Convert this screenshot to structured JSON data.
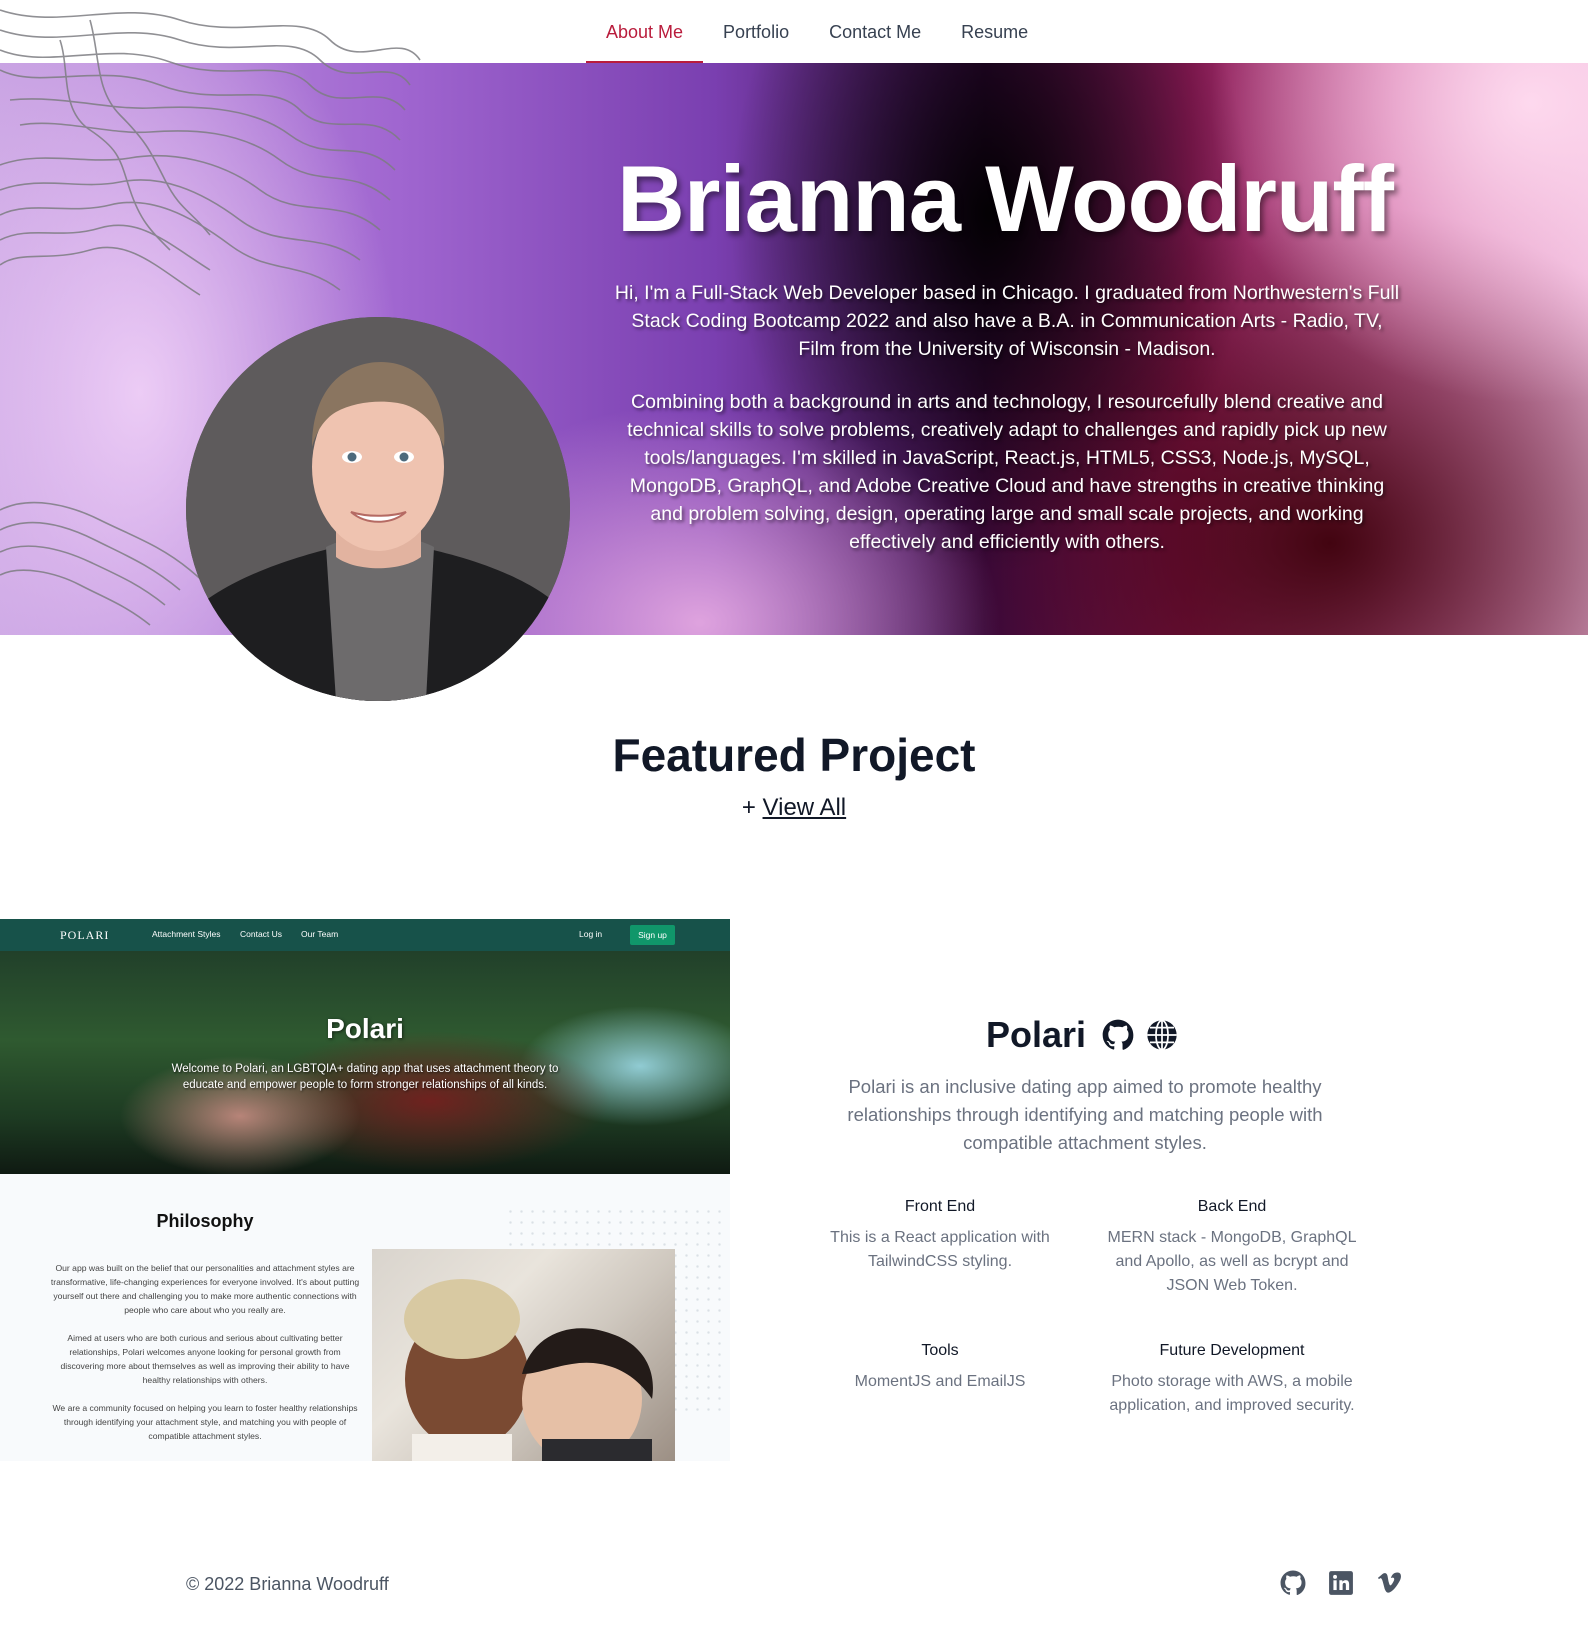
{
  "nav": {
    "items": [
      {
        "label": "About Me",
        "active": true
      },
      {
        "label": "Portfolio",
        "active": false
      },
      {
        "label": "Contact Me",
        "active": false
      },
      {
        "label": "Resume",
        "active": false
      }
    ],
    "active_color": "#b91c3c"
  },
  "hero": {
    "name": "Brianna Woodruff",
    "bio_1": "Hi, I'm a Full-Stack Web Developer based in Chicago. I graduated from Northwestern's Full Stack Coding Bootcamp 2022 and also have a B.A. in Communication Arts - Radio, TV, Film from the University of Wisconsin - Madison.",
    "bio_2": "Combining both a background in arts and technology, I resourcefully blend creative and technical skills to solve problems, creatively adapt to challenges and rapidly pick up new tools/languages. I'm skilled in JavaScript, React.js, HTML5, CSS3, Node.js, MySQL, MongoDB, GraphQL, and Adobe Creative Cloud and have strengths in creative thinking and problem solving, design, operating large and small scale projects, and working effectively and efficiently with others."
  },
  "featured": {
    "title": "Featured Project",
    "view_all_prefix": "+",
    "view_all_label": "View All"
  },
  "screenshot": {
    "logo": "POLARI",
    "nav_links": [
      "Attachment Styles",
      "Contact Us",
      "Our Team"
    ],
    "login": "Log in",
    "signup": "Sign up",
    "hero_title": "Polari",
    "hero_text": "Welcome to Polari, an LGBTQIA+ dating app that uses attachment theory to educate and empower people to form stronger relationships of all kinds.",
    "philosophy_title": "Philosophy",
    "philosophy_paragraphs": [
      "Our app was built on the belief that our personalities and attachment styles are transformative, life-changing experiences for everyone involved. It's about putting yourself out there and challenging you to make more authentic connections with people who care about who you really are.",
      "Aimed at users who are both curious and serious about cultivating better relationships, Polari welcomes anyone looking for personal growth from discovering more about themselves as well as improving their ability to have healthy relationships with others.",
      "We are a community focused on helping you learn to foster healthy relationships through identifying your attachment style, and matching you with people of compatible attachment styles."
    ],
    "brand_color": "#17524a",
    "signup_color": "#10976a"
  },
  "project": {
    "title": "Polari",
    "icons": [
      "github-icon",
      "globe-icon"
    ],
    "description": "Polari is an inclusive dating app aimed to promote healthy relationships through identifying and matching people with compatible attachment styles.",
    "features": [
      {
        "heading": "Front End",
        "text": "This is a React application with TailwindCSS styling."
      },
      {
        "heading": "Back End",
        "text": "MERN stack - MongoDB, GraphQL and Apollo, as well as bcrypt and JSON Web Token."
      },
      {
        "heading": "Tools",
        "text": "MomentJS and EmailJS"
      },
      {
        "heading": "Future Development",
        "text": "Photo storage with AWS, a mobile application, and improved security."
      }
    ]
  },
  "footer": {
    "copyright": "© 2022 Brianna Woodruff",
    "icons": [
      "github-icon",
      "linkedin-icon",
      "vimeo-icon"
    ]
  }
}
